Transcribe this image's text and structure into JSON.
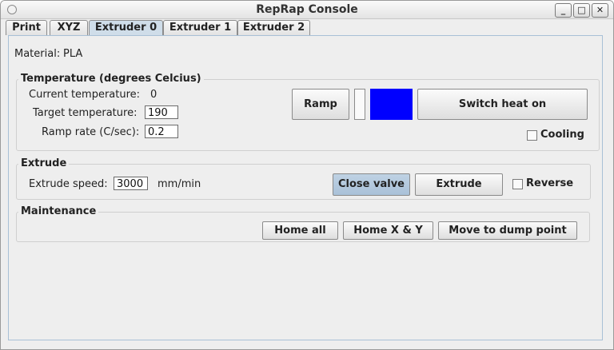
{
  "window": {
    "title": "RepRap Console",
    "controls": {
      "minimize": "_",
      "maximize": "□",
      "close": "✕"
    }
  },
  "tabs": [
    {
      "label": "Print"
    },
    {
      "label": "XYZ"
    },
    {
      "label": "Extruder 0",
      "selected": true
    },
    {
      "label": "Extruder 1"
    },
    {
      "label": "Extruder 2"
    }
  ],
  "material": {
    "label": "Material:",
    "value": "PLA"
  },
  "temperature": {
    "group_title": "Temperature (degrees Celcius)",
    "current_label": "Current temperature:",
    "current_value": "0",
    "target_label": "Target temperature:",
    "target_value": "190",
    "ramp_rate_label": "Ramp rate (C/sec):",
    "ramp_rate_value": "0.2",
    "ramp_button": "Ramp",
    "heater_color": "#0000ff",
    "switch_heat_button": "Switch heat on",
    "cooling_label": "Cooling"
  },
  "extrude": {
    "group_title": "Extrude",
    "speed_label": "Extrude speed:",
    "speed_value": "3000",
    "speed_unit": "mm/min",
    "close_valve_button": "Close valve",
    "extrude_button": "Extrude",
    "reverse_label": "Reverse"
  },
  "maintenance": {
    "group_title": "Maintenance",
    "home_all_button": "Home all",
    "home_xy_button": "Home X & Y",
    "dump_point_button": "Move to dump point"
  }
}
